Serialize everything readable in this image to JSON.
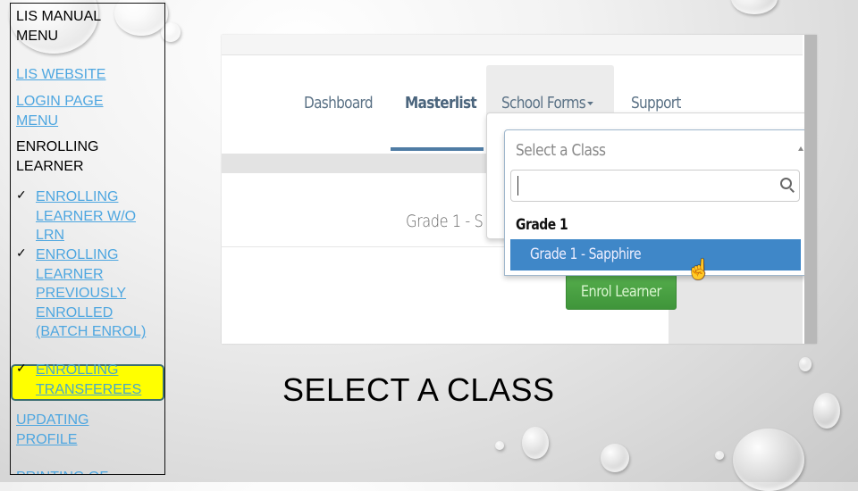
{
  "menu": {
    "title": "LIS MANUAL MENU",
    "links_top": [
      {
        "label": "LIS WEBSITE"
      },
      {
        "label": "LOGIN PAGE MENU"
      }
    ],
    "section_heading": "ENROLLING LEARNER",
    "sub_items": [
      {
        "label": "ENROLLING LEARNER W/O LRN",
        "highlighted": false
      },
      {
        "label": "ENROLLING LEARNER PREVIOUSLY ENROLLED (BATCH ENROL)",
        "highlighted": false
      },
      {
        "label": "ENROLLING TRANSFEREES",
        "highlighted": true
      }
    ],
    "links_bottom": [
      {
        "label": "UPDATING PROFILE"
      },
      {
        "label": "PRINTING OF"
      }
    ],
    "check_glyph": "✓",
    "highlight_color": "#ffff00",
    "link_color": "#4da6e0"
  },
  "screenshot": {
    "nav": {
      "items": [
        {
          "label": "Dashboard",
          "active": false
        },
        {
          "label": "Masterlist",
          "active": true
        },
        {
          "label": "School Forms",
          "active": false,
          "has_dropdown": true
        },
        {
          "label": "Support",
          "active": false
        }
      ],
      "accent_color": "#4f7ca4"
    },
    "class_label": "Grade 1 - S",
    "select": {
      "placeholder": "Select a Class",
      "search_value": "",
      "group_label": "Grade 1",
      "selected_option": "Grade 1 - Sapphire",
      "selected_bg": "#3f87c8"
    },
    "enrol_button": {
      "label": "Enrol Learner",
      "color": "#4a9f43"
    }
  },
  "caption": "SELECT A CLASS"
}
